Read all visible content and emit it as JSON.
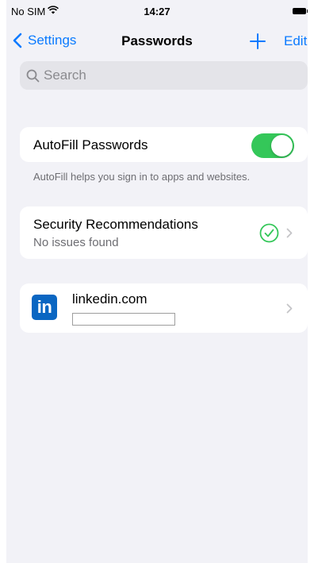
{
  "status_bar": {
    "carrier": "No SIM",
    "time": "14:27"
  },
  "nav": {
    "back_label": "Settings",
    "title": "Passwords",
    "edit_label": "Edit"
  },
  "search": {
    "placeholder": "Search",
    "value": ""
  },
  "autofill": {
    "label": "AutoFill Passwords",
    "enabled": true,
    "footer": "AutoFill helps you sign in to apps and websites."
  },
  "security": {
    "title": "Security Recommendations",
    "subtitle": "No issues found"
  },
  "accounts": [
    {
      "logo_text": "in",
      "site": "linkedin.com",
      "username": ""
    }
  ],
  "colors": {
    "accent": "#0a7aff",
    "toggle_on": "#34c759",
    "check": "#34c759",
    "linkedin": "#0a66c2",
    "background": "#f2f2f7"
  }
}
